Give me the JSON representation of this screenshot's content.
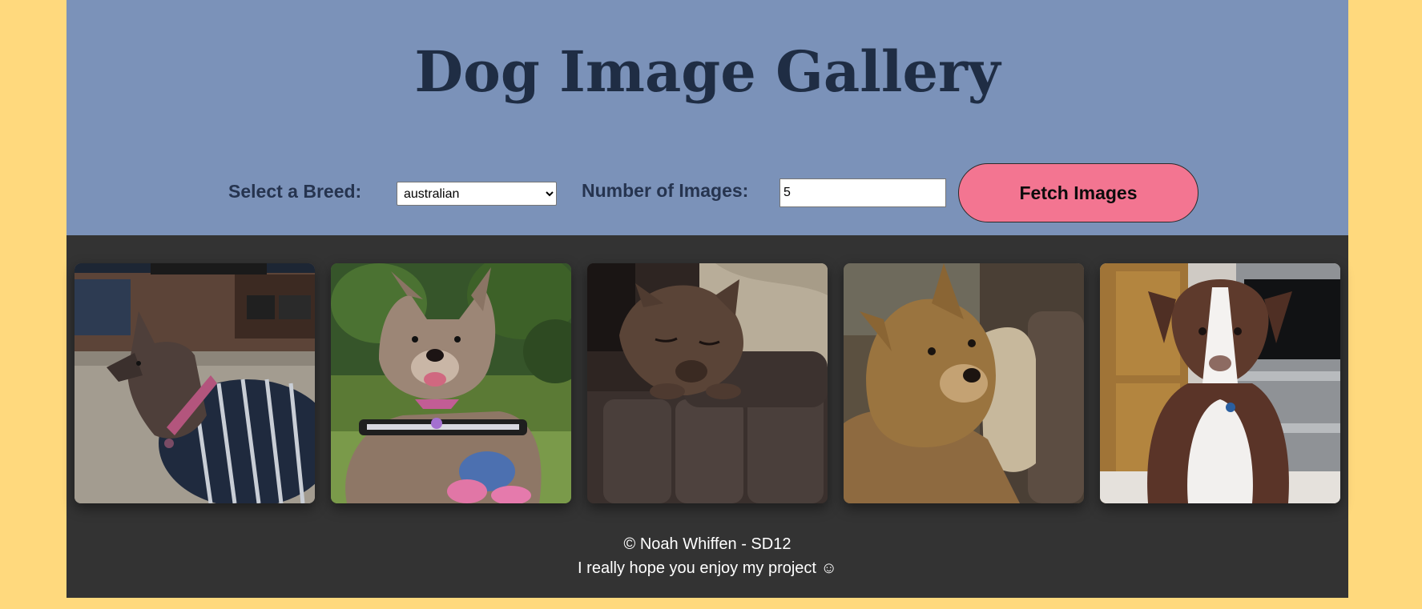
{
  "header": {
    "title": "Dog Image Gallery"
  },
  "controls": {
    "breed_label": "Select a Breed:",
    "breed_selected": "australian",
    "count_label": "Number of Images:",
    "count_value": "5",
    "fetch_label": "Fetch Images"
  },
  "gallery": {
    "images": [
      {
        "alt": "australian dog 1"
      },
      {
        "alt": "australian dog 2"
      },
      {
        "alt": "australian dog 3"
      },
      {
        "alt": "australian dog 4"
      },
      {
        "alt": "australian dog 5"
      }
    ]
  },
  "footer": {
    "copyright": "© Noah Whiffen - SD12",
    "message": "I really hope you enjoy my project ☺"
  },
  "colors": {
    "page_background": "#ffd97d",
    "header_background": "#7b92b9",
    "gallery_background": "#333333",
    "title_color": "#1f2d44",
    "button_color": "#f37591"
  }
}
